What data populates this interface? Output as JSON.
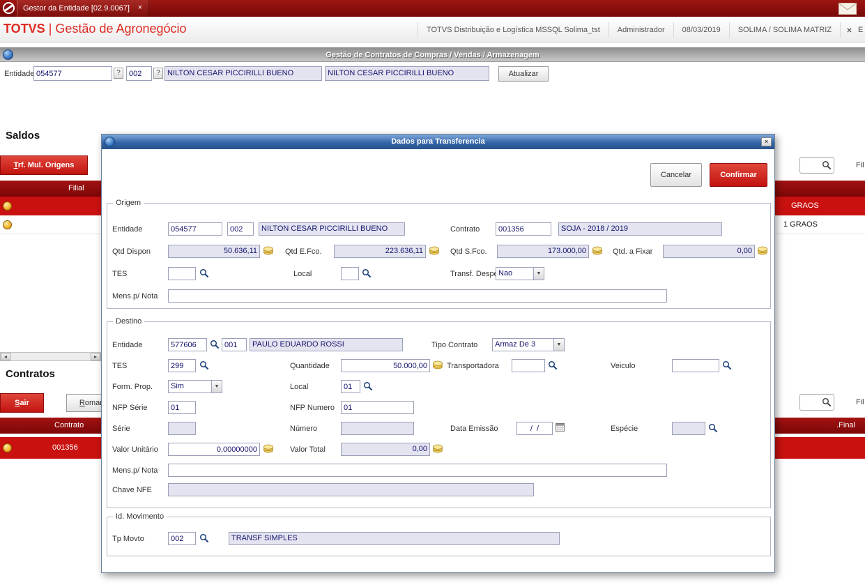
{
  "icons": {
    "close": "×",
    "help": "?",
    "dropdown": "▼",
    "scroll_left": "◄",
    "scroll_right": "►"
  },
  "colors": {
    "accent_red": "#c9110f",
    "header_red": "#8c0f0f",
    "dialog_blue": "#2d5d9f",
    "readonly_field_bg": "#e4e4f1"
  },
  "topbar": {
    "tab_title": "Gestor da Entidade [02.9.0067]"
  },
  "header": {
    "brand": "TOTVS",
    "divider": "|",
    "module": "Gestão de Agronegócio",
    "environment": "TOTVS Distribuição e Logística MSSQL Solima_tst",
    "user": "Administrador",
    "date": "08/03/2019",
    "branch": "SOLIMA / SOLIMA MATRIZ",
    "exit_partial": "E"
  },
  "toolbar": {
    "title": "Gestão de Contratos de Compras / Vendas / Armazenagem"
  },
  "entity_bar": {
    "label": "Entidade",
    "code": "054577",
    "store": "002",
    "name": "NILTON CESAR PICCIRILLI BUENO",
    "name2": "NILTON CESAR PICCIRILLI BUENO",
    "update_button": "Atualizar"
  },
  "saldos": {
    "title": "Saldos",
    "trf_button": "Trf. Mul. Origens",
    "col_filial": "Filial",
    "row1_text": "GRAOS",
    "row2_text": "1 GRAOS",
    "filter_partial": "Fil"
  },
  "contratos": {
    "title": "Contratos",
    "sair_button": "Sair",
    "romaneio_button": "Romaneio",
    "col_contrato": "Contrato",
    "col_final": ".Final",
    "row1_code": "001356",
    "filter_partial": "Fil"
  },
  "dialog": {
    "title": "Dados para Transferencia",
    "buttons": {
      "cancel": "Cancelar",
      "confirm": "Confirmar"
    },
    "origem": {
      "legend": "Origem",
      "entidade": {
        "label": "Entidade",
        "code": "054577",
        "loja": "002",
        "nome": "NILTON CESAR PICCIRILLI BUENO"
      },
      "contrato": {
        "label": "Contrato",
        "code": "001356",
        "desc": "SOJA  - 2018 / 2019"
      },
      "qtd_dispon": {
        "label": "Qtd Dispon",
        "value": "50.636,11"
      },
      "qtd_efco": {
        "label": "Qtd E.Fco.",
        "value": "223.636,11"
      },
      "qtd_sfco": {
        "label": "Qtd S.Fco.",
        "value": "173.000,00"
      },
      "qtd_fixar": {
        "label": "Qtd. a Fixar",
        "value": "0,00"
      },
      "tes": {
        "label": "TES",
        "value": ""
      },
      "local": {
        "label": "Local",
        "value": ""
      },
      "transf_despesa": {
        "label": "Transf. Despesa",
        "value": "Nao"
      },
      "mens": {
        "label": "Mens.p/ Nota",
        "value": ""
      }
    },
    "destino": {
      "legend": "Destino",
      "entidade": {
        "label": "Entidade",
        "code": "577606",
        "loja": "001",
        "nome": "PAULO EDUARDO ROSSI"
      },
      "tipo_contrato": {
        "label": "Tipo Contrato",
        "value": "Armaz De 3"
      },
      "tes": {
        "label": "TES",
        "value": "299"
      },
      "quantidade": {
        "label": "Quantidade",
        "value": "50.000,00"
      },
      "transportadora": {
        "label": "Transportadora",
        "value": ""
      },
      "veiculo": {
        "label": "Veiculo",
        "value": ""
      },
      "form_prop": {
        "label": "Form. Prop.",
        "value": "Sim"
      },
      "local": {
        "label": "Local",
        "value": "01"
      },
      "nfp_serie": {
        "label": "NFP Série",
        "value": "01"
      },
      "nfp_numero": {
        "label": "NFP Numero",
        "value": "01"
      },
      "serie": {
        "label": "Série",
        "value": ""
      },
      "numero": {
        "label": "Número",
        "value": ""
      },
      "data_emissao": {
        "label": "Data Emissão",
        "value": "/  /"
      },
      "especie": {
        "label": "Espécie",
        "value": ""
      },
      "valor_unitario": {
        "label": "Valor Unitário",
        "value": "0,00000000"
      },
      "valor_total": {
        "label": "Valor Total",
        "value": "0,00"
      },
      "mens": {
        "label": "Mens.p/ Nota",
        "value": ""
      },
      "chave_nfe": {
        "label": "Chave NFE",
        "value": ""
      }
    },
    "id_movimento": {
      "legend": "Id. Movimento",
      "tp_movto": {
        "label": "Tp Movto",
        "value": "002",
        "desc": "TRANSF SIMPLES"
      }
    }
  }
}
